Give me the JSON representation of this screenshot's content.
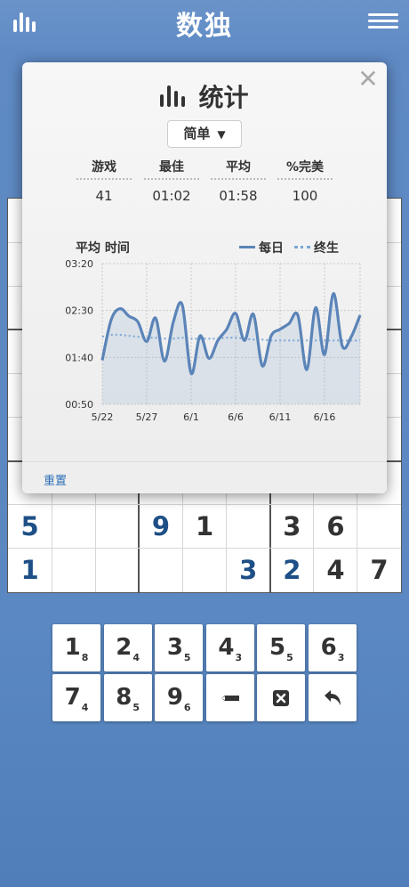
{
  "header": {
    "title": "数独",
    "stats_icon": "bar-chart-icon",
    "menu_icon": "hamburger-menu-icon"
  },
  "board": {
    "visible_rows": [
      {
        "row": 7,
        "cells": [
          {
            "col": 0,
            "v": "5",
            "type": "user"
          },
          {
            "col": 1,
            "v": "",
            "type": "empty"
          },
          {
            "col": 2,
            "v": "",
            "type": "empty"
          },
          {
            "col": 3,
            "v": "9",
            "type": "user"
          },
          {
            "col": 4,
            "v": "1",
            "type": "given"
          },
          {
            "col": 5,
            "v": "",
            "type": "empty"
          },
          {
            "col": 6,
            "v": "3",
            "type": "given"
          },
          {
            "col": 7,
            "v": "6",
            "type": "given"
          },
          {
            "col": 8,
            "v": "",
            "type": "empty"
          }
        ]
      },
      {
        "row": 8,
        "cells": [
          {
            "col": 0,
            "v": "1",
            "type": "user"
          },
          {
            "col": 1,
            "v": "",
            "type": "empty"
          },
          {
            "col": 2,
            "v": "",
            "type": "empty"
          },
          {
            "col": 3,
            "v": "",
            "type": "empty"
          },
          {
            "col": 4,
            "v": "",
            "type": "empty"
          },
          {
            "col": 5,
            "v": "3",
            "type": "user"
          },
          {
            "col": 6,
            "v": "2",
            "type": "user"
          },
          {
            "col": 7,
            "v": "4",
            "type": "given"
          },
          {
            "col": 8,
            "v": "7",
            "type": "given"
          }
        ]
      }
    ]
  },
  "numpad": {
    "digits": [
      {
        "n": "1",
        "count": "8"
      },
      {
        "n": "2",
        "count": "4"
      },
      {
        "n": "3",
        "count": "5"
      },
      {
        "n": "4",
        "count": "3"
      },
      {
        "n": "5",
        "count": "5"
      },
      {
        "n": "6",
        "count": "3"
      },
      {
        "n": "7",
        "count": "4"
      },
      {
        "n": "8",
        "count": "5"
      },
      {
        "n": "9",
        "count": "6"
      }
    ],
    "tools": [
      "pencil-icon",
      "erase-icon",
      "undo-icon"
    ]
  },
  "stats_modal": {
    "title": "统计",
    "close_label": "✕",
    "difficulty": "简单",
    "dropdown_arrow": "▼",
    "stats": [
      {
        "label": "游戏",
        "value": "41"
      },
      {
        "label": "最佳",
        "value": "01:02"
      },
      {
        "label": "平均",
        "value": "01:58"
      },
      {
        "label": "%完美",
        "value": "100"
      }
    ],
    "chart_title": "平均 时间",
    "reset_label": "重置"
  },
  "chart_data": {
    "type": "line",
    "title": "平均 时间",
    "x": [
      "5/22",
      "5/23",
      "5/24",
      "5/25",
      "5/26",
      "5/27",
      "5/28",
      "5/29",
      "5/30",
      "5/31",
      "6/1",
      "6/2",
      "6/3",
      "6/4",
      "6/5",
      "6/6",
      "6/7",
      "6/8",
      "6/9",
      "6/10",
      "6/11",
      "6/12",
      "6/13",
      "6/14",
      "6/15",
      "6/16",
      "6/17",
      "6/18",
      "6/19",
      "6/20"
    ],
    "x_ticks": [
      "5/22",
      "5/27",
      "6/1",
      "6/6",
      "6/11",
      "6/16"
    ],
    "y_ticks": [
      "00:50",
      "01:40",
      "02:30",
      "03:20"
    ],
    "ylim_seconds": [
      50,
      200
    ],
    "series": [
      {
        "name": "每日",
        "style": "solid",
        "color": "#5b84b8",
        "values_seconds": [
          97,
          140,
          152,
          144,
          138,
          117,
          142,
          96,
          138,
          156,
          83,
          123,
          99,
          118,
          130,
          147,
          118,
          146,
          91,
          123,
          130,
          136,
          145,
          87,
          153,
          103,
          168,
          112,
          122,
          145
        ]
      },
      {
        "name": "终生",
        "style": "dotted",
        "color": "#7aa6d6",
        "values_seconds": [
          122,
          124,
          124,
          123,
          122,
          121,
          121,
          120,
          120,
          121,
          120,
          120,
          120,
          120,
          121,
          121,
          120,
          119,
          119,
          118,
          118,
          118,
          118,
          118,
          118,
          118,
          118,
          118,
          118,
          118
        ]
      }
    ],
    "grid": true,
    "legend_position": "top-right"
  }
}
